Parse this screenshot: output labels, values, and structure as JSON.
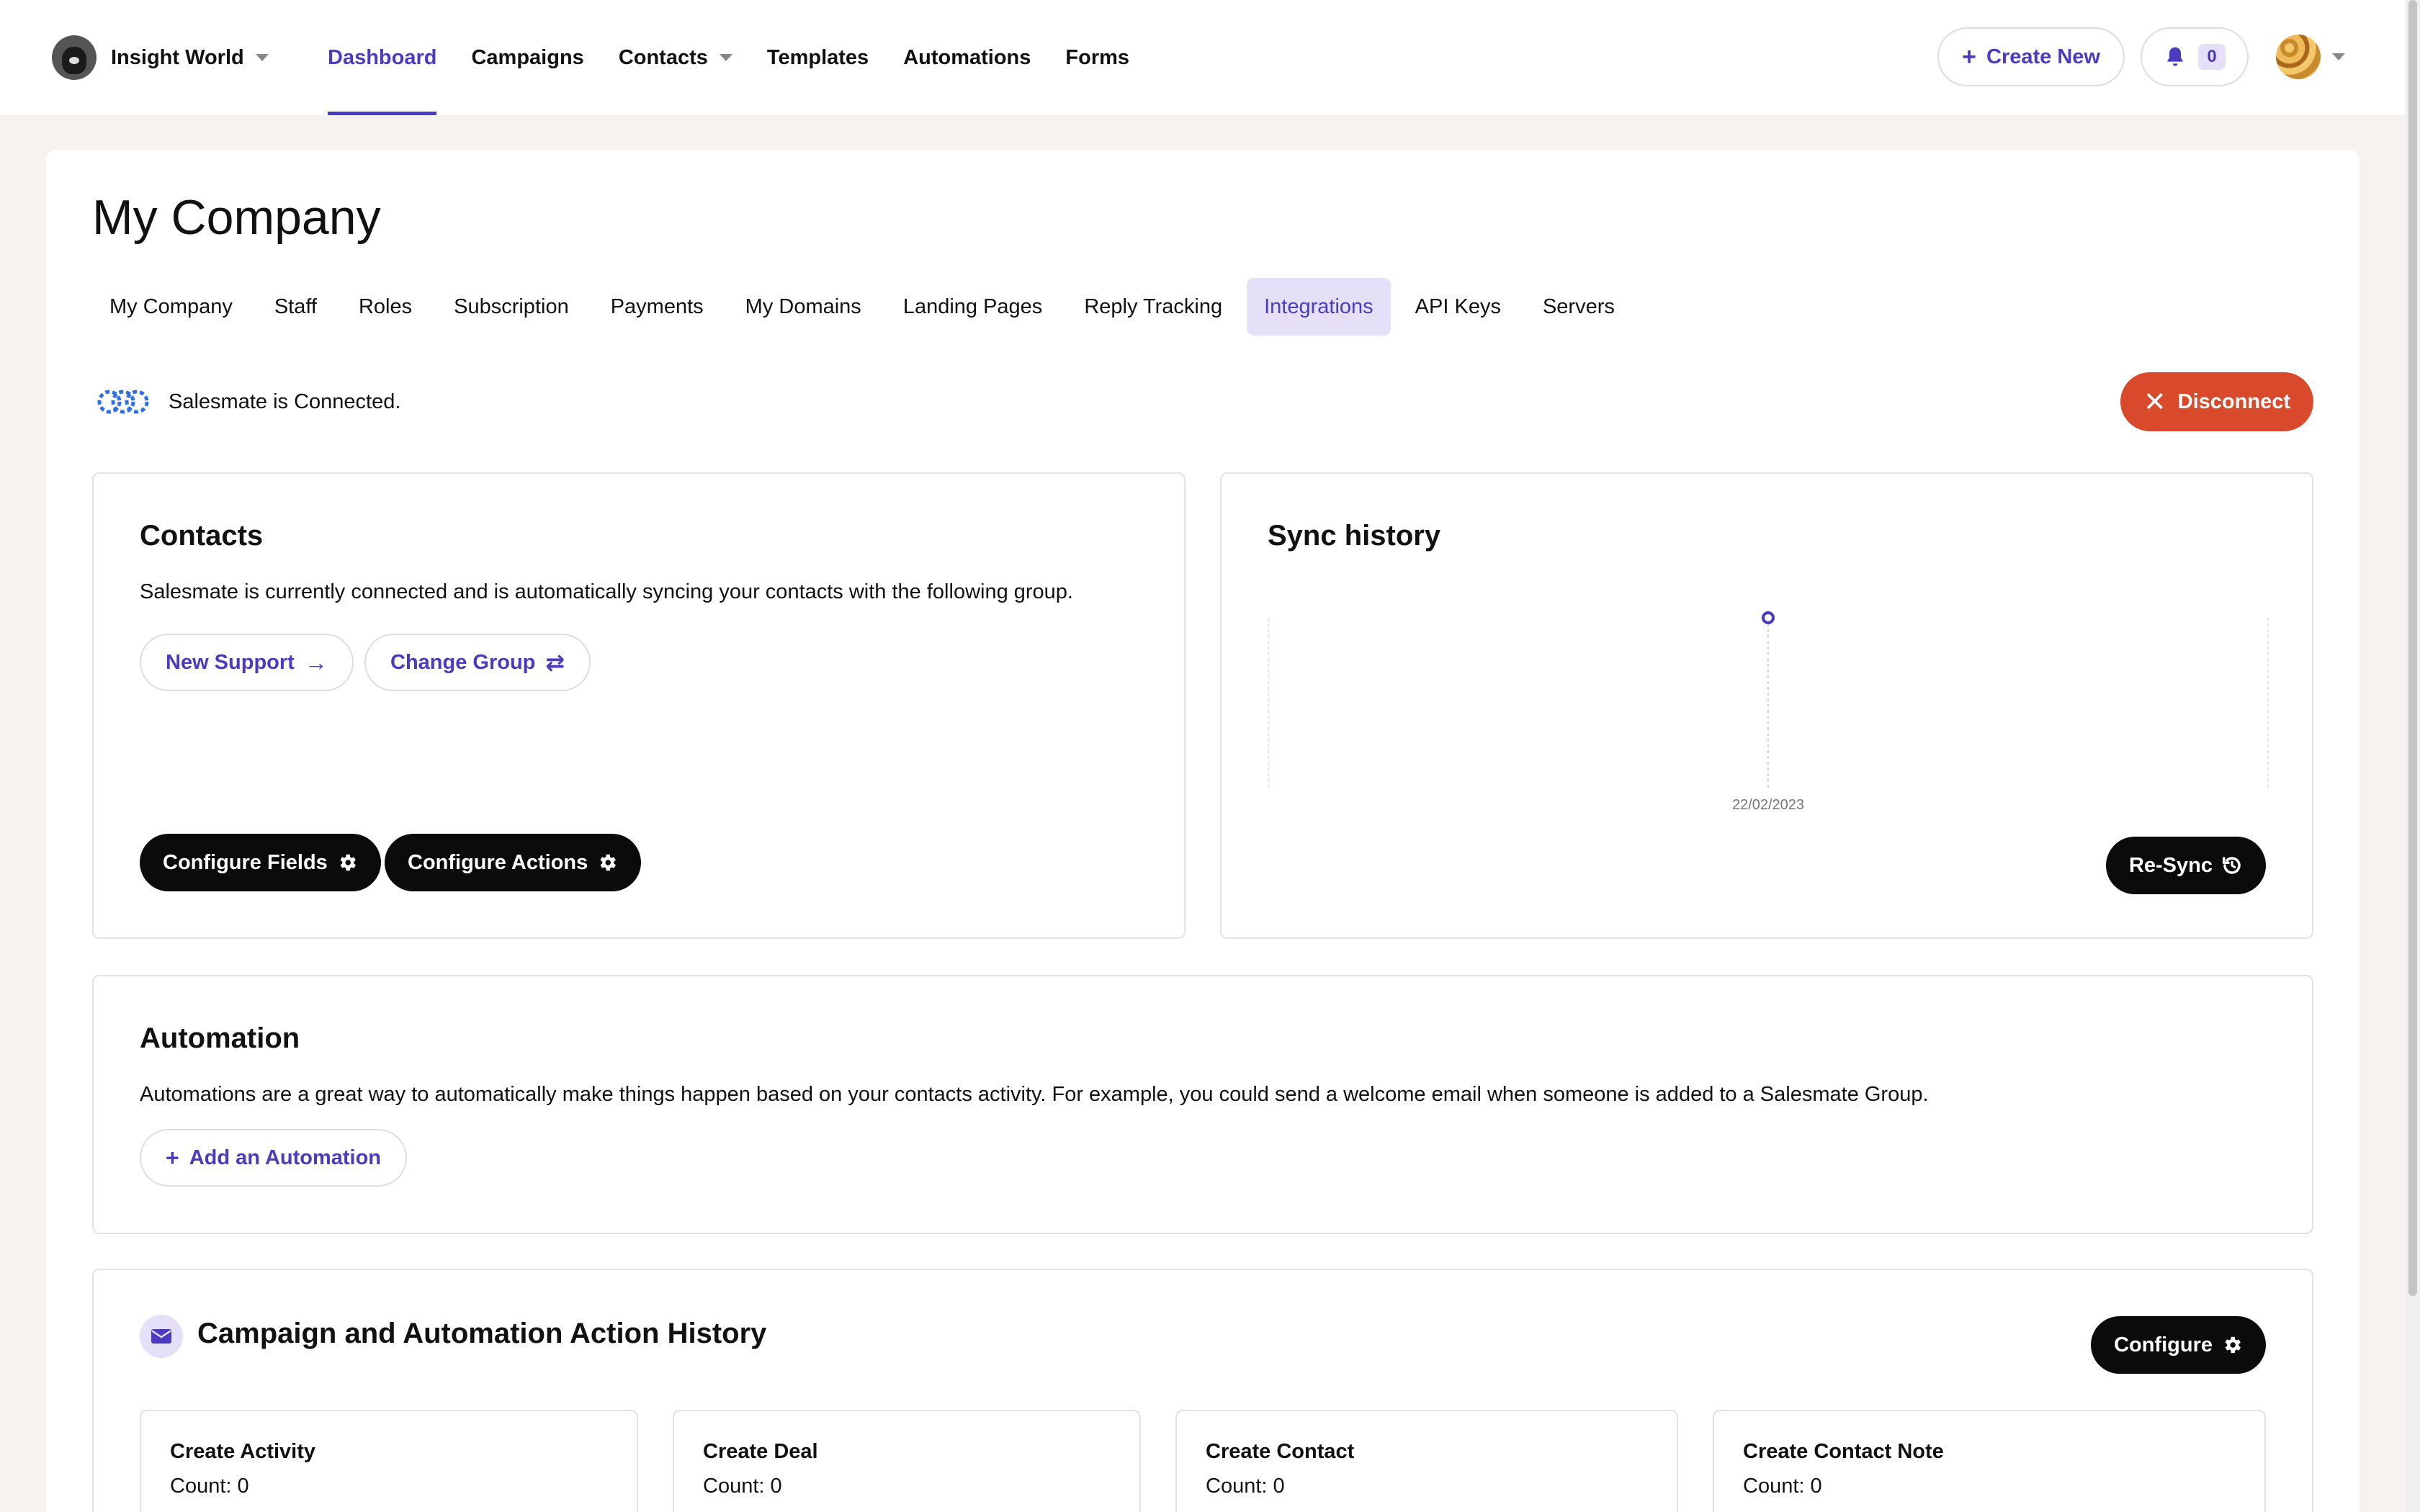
{
  "brand": {
    "name": "Insight World"
  },
  "nav": {
    "links": [
      {
        "label": "Dashboard",
        "active": true
      },
      {
        "label": "Campaigns",
        "active": false
      },
      {
        "label": "Contacts",
        "active": false,
        "dropdown": true
      },
      {
        "label": "Templates",
        "active": false
      },
      {
        "label": "Automations",
        "active": false
      },
      {
        "label": "Forms",
        "active": false
      }
    ],
    "create_new_label": "Create New",
    "notification_count": "0"
  },
  "page": {
    "title": "My Company",
    "subtabs": [
      {
        "label": "My Company",
        "active": false
      },
      {
        "label": "Staff",
        "active": false
      },
      {
        "label": "Roles",
        "active": false
      },
      {
        "label": "Subscription",
        "active": false
      },
      {
        "label": "Payments",
        "active": false
      },
      {
        "label": "My Domains",
        "active": false
      },
      {
        "label": "Landing Pages",
        "active": false
      },
      {
        "label": "Reply Tracking",
        "active": false
      },
      {
        "label": "Integrations",
        "active": true
      },
      {
        "label": "API Keys",
        "active": false
      },
      {
        "label": "Servers",
        "active": false
      }
    ]
  },
  "integration": {
    "status_text": "Salesmate is Connected.",
    "disconnect_label": "Disconnect"
  },
  "contacts_panel": {
    "title": "Contacts",
    "description": "Salesmate is currently connected and is automatically syncing your contacts with the following group.",
    "group_button_label": "New Support",
    "change_group_label": "Change Group",
    "configure_fields_label": "Configure Fields",
    "configure_actions_label": "Configure Actions"
  },
  "sync_panel": {
    "title": "Sync history",
    "resync_label": "Re-Sync"
  },
  "automation_panel": {
    "title": "Automation",
    "description": "Automations are a great way to automatically make things happen based on your contacts activity. For example, you could send a welcome email when someone is added to a Salesmate Group.",
    "add_label": "Add an Automation"
  },
  "history_panel": {
    "title": "Campaign and Automation Action History",
    "configure_label": "Configure",
    "cards": [
      {
        "title": "Create Activity",
        "count": "Count: 0"
      },
      {
        "title": "Create Deal",
        "count": "Count: 0"
      },
      {
        "title": "Create Contact",
        "count": "Count: 0"
      },
      {
        "title": "Create Contact Note",
        "count": "Count: 0"
      }
    ]
  },
  "colors": {
    "accent": "#4b3bbf",
    "accent_soft": "#e5e0f7",
    "danger": "#d9492b",
    "dark_button": "#0b0b0b",
    "page_bg": "#f5f2ef"
  },
  "chart_data": {
    "type": "line",
    "x": [
      "22/02/2023"
    ],
    "series": [
      {
        "values": [
          1
        ]
      }
    ],
    "title": "Sync history",
    "xlabel": "",
    "ylabel": ""
  }
}
